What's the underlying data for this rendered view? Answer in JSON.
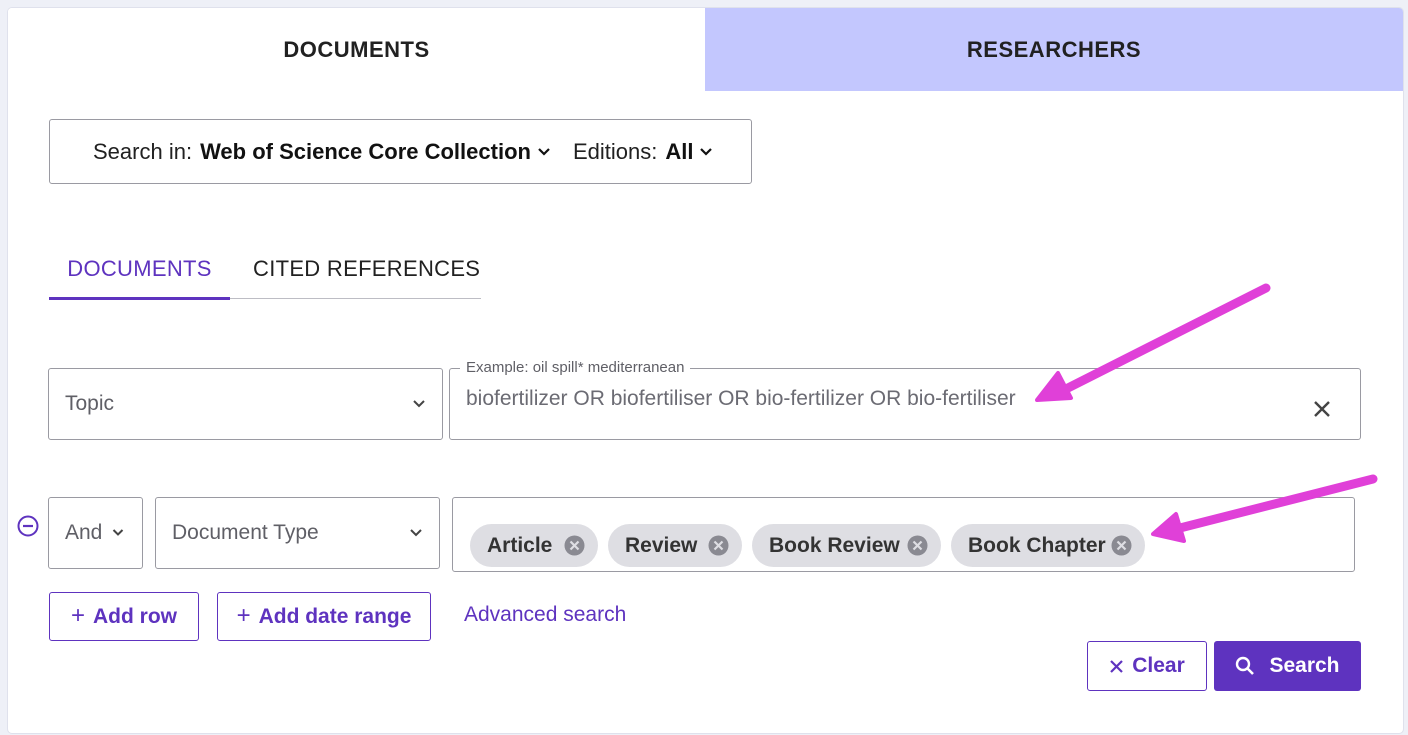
{
  "top_tabs": {
    "documents": "DOCUMENTS",
    "researchers": "RESEARCHERS"
  },
  "search_scope": {
    "search_in_label": "Search in:",
    "search_in_value": "Web of Science Core Collection",
    "editions_label": "Editions:",
    "editions_value": "All"
  },
  "sub_tabs": {
    "documents": "DOCUMENTS",
    "cited_references": "CITED REFERENCES"
  },
  "row1": {
    "field": "Topic",
    "query_placeholder_label": "Example: oil spill* mediterranean",
    "query_value": "biofertilizer OR biofertiliser OR bio-fertilizer OR bio-fertiliser"
  },
  "row2": {
    "operator": "And",
    "field": "Document Type",
    "chips": [
      "Article",
      "Review",
      "Book Review",
      "Book Chapter"
    ]
  },
  "actions": {
    "add_row": "Add row",
    "add_date_range": "Add date range",
    "advanced_search": "Advanced search",
    "clear": "Clear",
    "search": "Search"
  },
  "colors": {
    "accent": "#5e33bf",
    "inactive_tab_bg": "#c3c7fe",
    "chip_bg": "#dedee3",
    "annotation_arrow": "#e040d8"
  },
  "icons": [
    "chevron-down-icon",
    "close-icon",
    "minus-circle-icon",
    "chip-remove-icon",
    "plus-icon",
    "search-icon",
    "annotation-arrow"
  ]
}
